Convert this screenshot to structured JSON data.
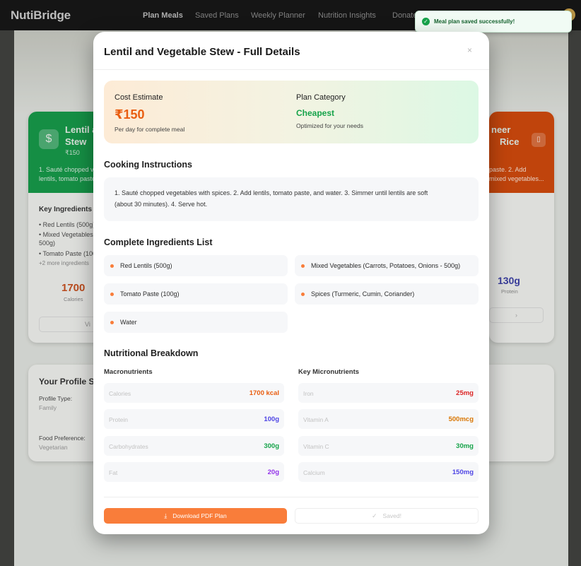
{
  "nav": {
    "brand": "NutiBridge",
    "links": [
      "Plan Meals",
      "Saved Plans",
      "Weekly Planner",
      "Nutrition Insights",
      "Donate"
    ]
  },
  "toast": {
    "message": "Meal plan saved successfully!",
    "icon": "check-circle-icon"
  },
  "background": {
    "left_card": {
      "title_line1": "Lentil a",
      "title_line2": "Stew",
      "price": "₹150",
      "icon": "$",
      "desc_line1": "1. Sauté chopped ve",
      "desc_line2": "lentils, tomato paste",
      "key_ingredients_label": "Key Ingredients",
      "items": [
        "• Red Lentils (500g)",
        "• Mixed Vegetables",
        "500g)",
        "• Tomato Paste (100"
      ],
      "more": "+2 more ingredients",
      "calories_value": "1700",
      "calories_label": "Calories",
      "view_label": "Vi"
    },
    "right_card": {
      "title_line1": "neer",
      "title_line2": "Rice",
      "desc_line1": "paste. 2. Add",
      "desc_line2": "mixed vegetables...",
      "protein_value": "130g",
      "protein_label": "Protein"
    },
    "profile": {
      "title": "Your Profile S",
      "type_label": "Profile Type:",
      "type_value": "Family",
      "food_label": "Food Preference:",
      "food_value": "Vegetarian"
    }
  },
  "modal": {
    "title": "Lentil and Vegetable Stew - Full Details",
    "close": "×",
    "cost": {
      "label": "Cost Estimate",
      "value": "₹150",
      "note": "Per day for complete meal"
    },
    "category": {
      "label": "Plan Category",
      "value": "Cheapest",
      "note": "Optimized for your needs"
    },
    "instructions_title": "Cooking Instructions",
    "instructions_line1": "1. Sauté chopped vegetables with spices. 2. Add lentils, tomato paste, and water. 3. Simmer until lentils are soft",
    "instructions_line2": "(about 30 minutes). 4. Serve hot.",
    "ingredients_title": "Complete Ingredients List",
    "ingredients": [
      "Red Lentils (500g)",
      "Mixed Vegetables (Carrots, Potatoes, Onions - 500g)",
      "Tomato Paste (100g)",
      "Spices (Turmeric, Cumin, Coriander)",
      "Water"
    ],
    "nutrition_title": "Nutritional Breakdown",
    "macro_title": "Macronutrients",
    "micro_title": "Key Micronutrients",
    "macros": [
      {
        "name": "Calories",
        "value": "1700 kcal",
        "color": "#e95d10"
      },
      {
        "name": "Protein",
        "value": "100g",
        "color": "#4f46e5"
      },
      {
        "name": "Carbohydrates",
        "value": "300g",
        "color": "#16a34a"
      },
      {
        "name": "Fat",
        "value": "20g",
        "color": "#9333ea"
      }
    ],
    "micros": [
      {
        "name": "Iron",
        "value": "25mg",
        "color": "#dc2626"
      },
      {
        "name": "Vitamin A",
        "value": "500mcg",
        "color": "#d97706"
      },
      {
        "name": "Vitamin C",
        "value": "30mg",
        "color": "#16a34a"
      },
      {
        "name": "Calcium",
        "value": "150mg",
        "color": "#4f46e5"
      }
    ],
    "download_label": "Download PDF Plan",
    "saved_label": "Saved!"
  }
}
